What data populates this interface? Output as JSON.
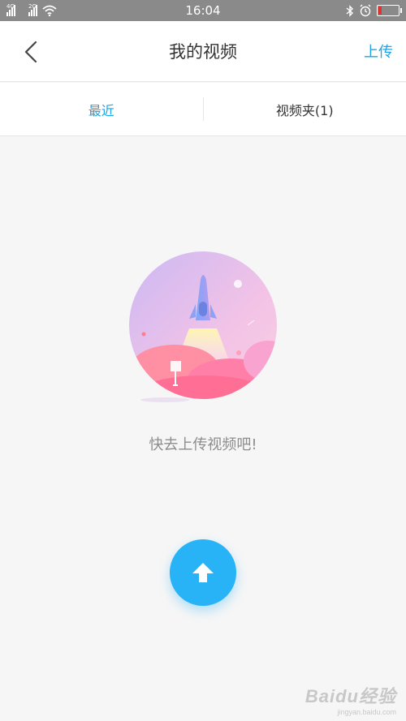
{
  "status_bar": {
    "network_1": "4G",
    "network_2": "2G",
    "time": "16:04",
    "battery_level": 0.15,
    "icons": [
      "signal-icon",
      "wifi-icon",
      "bluetooth-icon",
      "alarm-icon",
      "battery-icon"
    ]
  },
  "header": {
    "title": "我的视频",
    "upload_label": "上传",
    "back_icon": "chevron-left-icon"
  },
  "tabs": [
    {
      "label": "最近",
      "active": true
    },
    {
      "label": "视频夹(1)",
      "active": false
    }
  ],
  "empty_state": {
    "message": "快去上传视频吧!"
  },
  "fab": {
    "icon": "upload-arrow-icon"
  },
  "watermark": {
    "logo": "Baidu经验",
    "url": "jingyan.baidu.com"
  },
  "colors": {
    "accent": "#1aa6e8",
    "fab": "#27b3f5",
    "status_bar": "#8a8a8a",
    "battery_low": "#e0322e"
  }
}
